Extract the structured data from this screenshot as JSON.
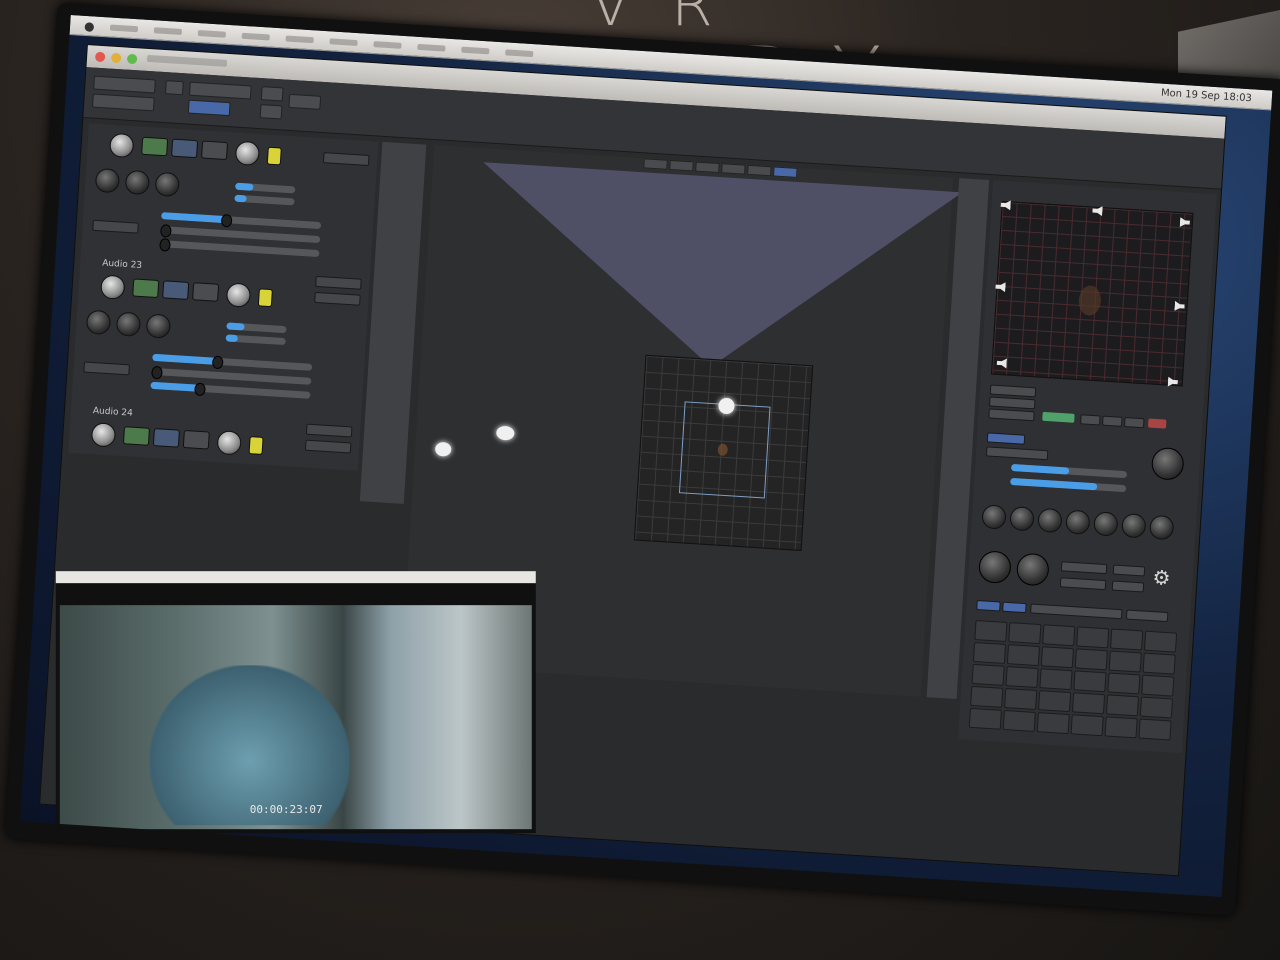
{
  "backdrop": {
    "sign_top": "VR",
    "sign_text": "READY"
  },
  "menubar": {
    "clock": "Mon 19 Sep 18:03"
  },
  "strips": [
    {
      "name": ""
    },
    {
      "name": "Audio 23"
    },
    {
      "name": "Audio 24"
    }
  ],
  "video": {
    "timecode": "00:00:23:07"
  },
  "colors": {
    "accent": "#4a9ee8",
    "panel": "#2a2b2d",
    "grid_line": "#4a2a2e"
  },
  "icons": {
    "apple": "apple-icon",
    "gear": "gear-icon",
    "speaker": "speaker-icon"
  }
}
